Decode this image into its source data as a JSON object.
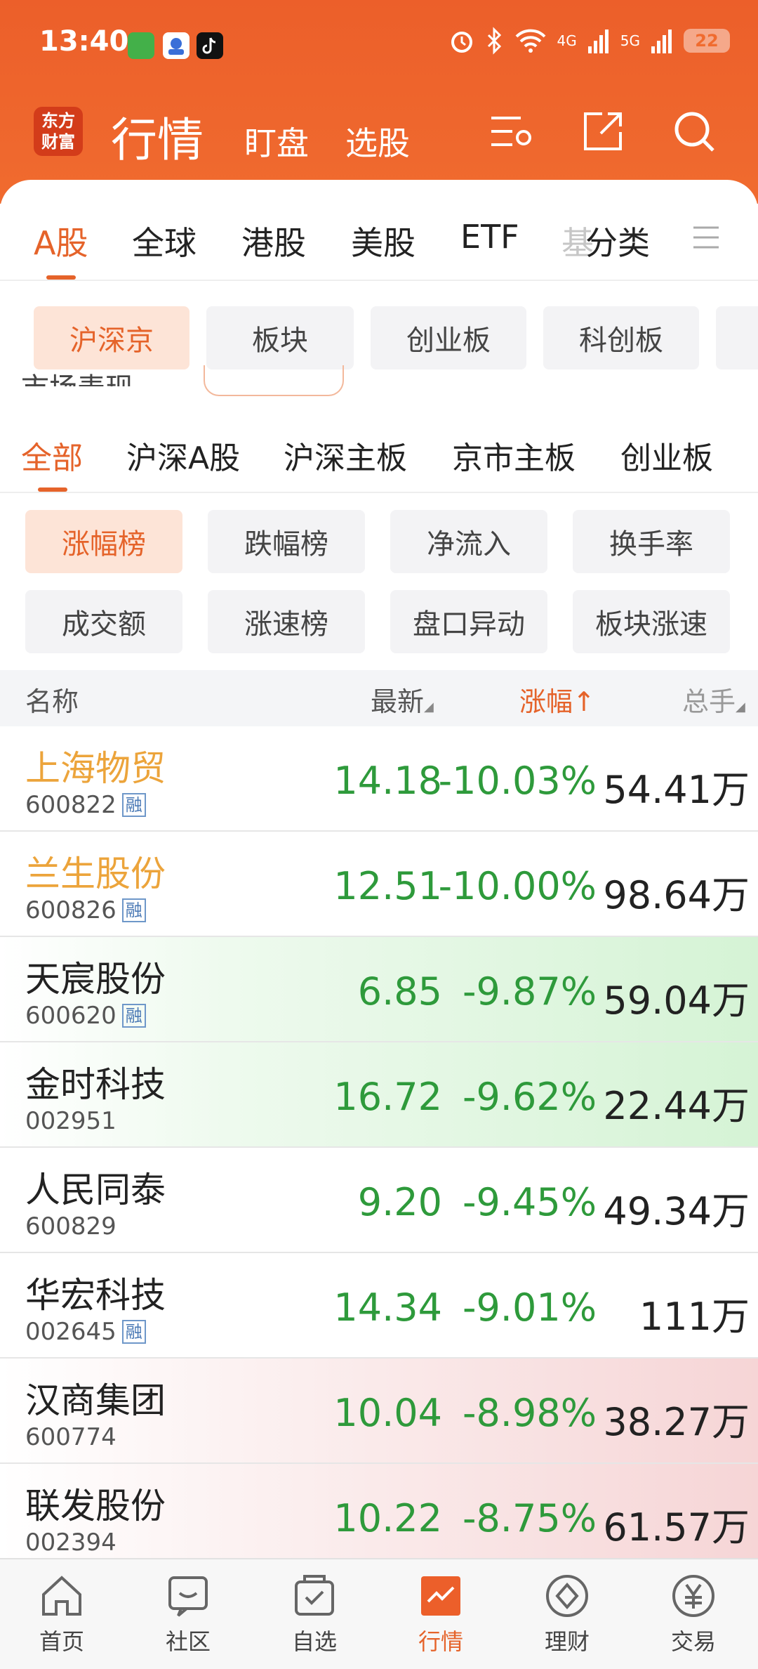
{
  "status_bar": {
    "time": "13:40",
    "battery": "22",
    "net1": "4G",
    "net2": "5G"
  },
  "header": {
    "logo_text": "东方财富",
    "title": "行情",
    "links": [
      "盯盘",
      "选股"
    ],
    "icons": [
      "settings-list-icon",
      "share-icon",
      "search-icon"
    ]
  },
  "market_tabs": {
    "items": [
      "A股",
      "全球",
      "港股",
      "美股",
      "ETF",
      "基",
      "分类"
    ],
    "active_index": 0,
    "more_icon": "menu-icon"
  },
  "scope_chips": {
    "items": [
      "沪深京",
      "板块",
      "创业板",
      "科创板"
    ],
    "active_index": 0
  },
  "hidden_behind": "市场表现",
  "sub_tabs": {
    "items": [
      "全部",
      "沪深A股",
      "沪深主板",
      "京市主板",
      "创业板"
    ],
    "active_index": 0
  },
  "rank_buttons": {
    "items": [
      "涨幅榜",
      "跌幅榜",
      "净流入",
      "换手率",
      "成交额",
      "涨速榜",
      "盘口异动",
      "板块涨速"
    ],
    "active_index": 0
  },
  "table": {
    "columns": [
      "名称",
      "最新",
      "涨幅↑",
      "总手"
    ],
    "sorted_column": 2,
    "margin_badge": "融",
    "rows": [
      {
        "name": "上海物贸",
        "code": "600822",
        "margin": true,
        "price": "14.18",
        "change": "-10.03%",
        "volume": "54.41万",
        "highlight": true,
        "bg": "none"
      },
      {
        "name": "兰生股份",
        "code": "600826",
        "margin": true,
        "price": "12.51",
        "change": "-10.00%",
        "volume": "98.64万",
        "highlight": true,
        "bg": "none"
      },
      {
        "name": "天宸股份",
        "code": "600620",
        "margin": true,
        "price": "6.85",
        "change": "-9.87%",
        "volume": "59.04万",
        "highlight": false,
        "bg": "green"
      },
      {
        "name": "金时科技",
        "code": "002951",
        "margin": false,
        "price": "16.72",
        "change": "-9.62%",
        "volume": "22.44万",
        "highlight": false,
        "bg": "green"
      },
      {
        "name": "人民同泰",
        "code": "600829",
        "margin": false,
        "price": "9.20",
        "change": "-9.45%",
        "volume": "49.34万",
        "highlight": false,
        "bg": "none"
      },
      {
        "name": "华宏科技",
        "code": "002645",
        "margin": true,
        "price": "14.34",
        "change": "-9.01%",
        "volume": "111万",
        "highlight": false,
        "bg": "none"
      },
      {
        "name": "汉商集团",
        "code": "600774",
        "margin": false,
        "price": "10.04",
        "change": "-8.98%",
        "volume": "38.27万",
        "highlight": false,
        "bg": "red"
      },
      {
        "name": "联发股份",
        "code": "002394",
        "margin": false,
        "price": "10.22",
        "change": "-8.75%",
        "volume": "61.57万",
        "highlight": false,
        "bg": "red"
      }
    ]
  },
  "bottom_nav": {
    "items": [
      "首页",
      "社区",
      "自选",
      "行情",
      "理财",
      "交易"
    ],
    "active_index": 3
  },
  "colors": {
    "brand": "#ec5f2a",
    "accent": "#e5632a",
    "down_green": "#2e9a3b",
    "highlight_name": "#eca43b"
  }
}
